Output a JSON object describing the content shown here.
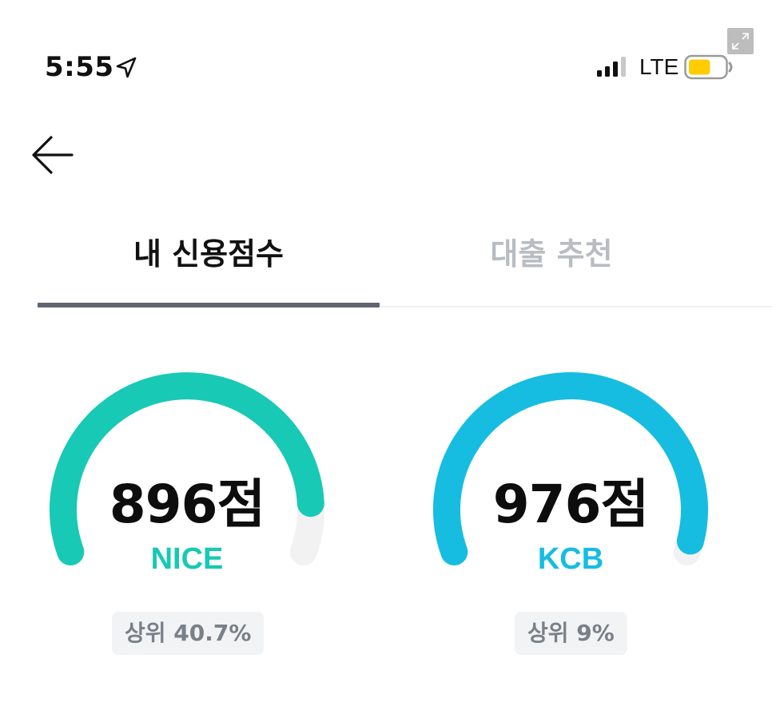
{
  "status_bar": {
    "time": "5:55",
    "network": "LTE",
    "location_icon": "location-arrow-icon",
    "signal_icon": "cellular-signal-icon",
    "battery_icon": "battery-icon",
    "battery_color": "#ffcc00",
    "battery_level": 0.6
  },
  "header": {
    "back_icon": "back-arrow-icon"
  },
  "tabs": [
    {
      "label": "내 신용점수",
      "active": true
    },
    {
      "label": "대출 추천",
      "active": false
    }
  ],
  "colors": {
    "nice": "#18c9b5",
    "kcb": "#16bde0",
    "track": "#f2f2f2",
    "tab_active": "#111111",
    "tab_inactive": "#b8bcc3",
    "tab_indicator": "#5f6670"
  },
  "scores": [
    {
      "agency": "NICE",
      "score_text": "896점",
      "score": 896,
      "max": 1000,
      "rank": "상위 40.7%"
    },
    {
      "agency": "KCB",
      "score_text": "976점",
      "score": 976,
      "max": 1000,
      "rank": "상위 9%"
    }
  ]
}
